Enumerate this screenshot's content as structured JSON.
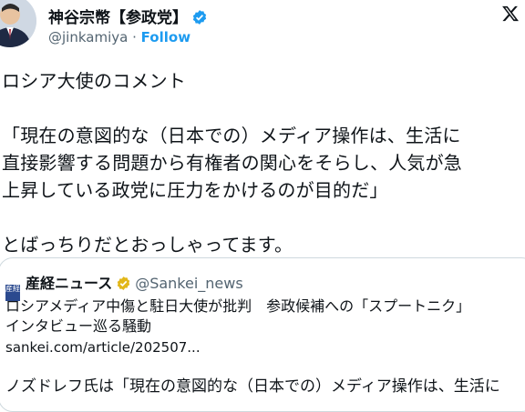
{
  "author": {
    "name": "神谷宗幣【参政党】",
    "handle": "@jinkamiya",
    "separator": "·",
    "follow_label": "Follow"
  },
  "tweet": {
    "text": "ロシア大使のコメント\n\n「現在の意図的な（日本での）メディア操作は、生活に\n直接影響する問題から有権者の関心をそらし、人気が急\n上昇している政党に圧力をかけるのが目的だ」\n\nとばっちりだとおっしゃってます。"
  },
  "quoted": {
    "logo_text": "産経",
    "name": "産経ニュース",
    "handle": "@Sankei_news",
    "title": "ロシアメディア中傷と駐日大使が批判　参政候補への「スプートニク」\nインタビュー巡る騒動",
    "url": "sankei.com/article/202507...",
    "body_preview": "ノズドレフ氏は「現在の意図的な（日本での）メディア操作は、生活に"
  },
  "colors": {
    "accent": "#1d9bf0",
    "gold_badge": "#e2b719",
    "text": "#0f1419",
    "secondary": "#536471"
  },
  "icons": [
    "avatar",
    "verified-badge-icon",
    "x-logo-icon",
    "gold-verified-badge-icon"
  ]
}
